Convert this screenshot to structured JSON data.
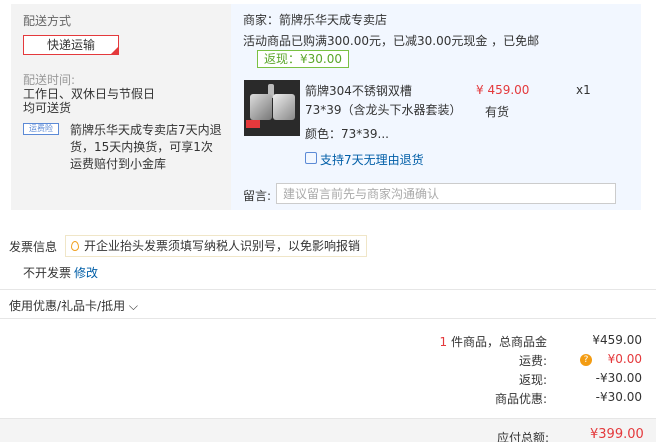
{
  "shipping": {
    "title": "配送方式",
    "method": "快递运输",
    "time_label": "配送时间:",
    "time_line1": "工作日、双休日与节假日",
    "time_line2": "均可送货",
    "return_badge": "运费险",
    "return_lines": [
      "箭牌乐华天成专卖店7天内退",
      "货，15天内换货，可享1次",
      "运费赔付到小金库"
    ]
  },
  "shop": {
    "name": "商家：箭牌乐华天成专卖店",
    "promo": "活动商品已购满300.00元，已减30.00元现金 ，已免邮",
    "rebate": "返现：¥30.00"
  },
  "product": {
    "name_line1": "箭牌304不锈钢双槽",
    "name_line2": "73*39（含龙头下水器套装）",
    "price": "¥ 459.00",
    "qty": "x1",
    "stock": "有货",
    "color": "颜色：73*39...",
    "support": "支持7天无理由退货"
  },
  "note": {
    "label": "留言:",
    "placeholder": "建议留言前先与商家沟通确认"
  },
  "invoice": {
    "label": "发票信息",
    "tip": "开企业抬头发票须填写纳税人识别号，以免影响报销",
    "value": "不开发票",
    "edit": "修改"
  },
  "coupon": {
    "label": "使用优惠/礼品卡/抵用 ⌵"
  },
  "summary": {
    "count_num": "1",
    "count_text": "件商品，总商品金",
    "goods_total": "¥459.00",
    "freight_label": "运费:",
    "freight_icon": "?",
    "freight": "¥0.00",
    "rebate_label": "返现:",
    "rebate": "-¥30.00",
    "discount_label": "商品优惠:",
    "discount": "-¥30.00",
    "total_label": "应付总额:",
    "total": "¥399.00"
  }
}
